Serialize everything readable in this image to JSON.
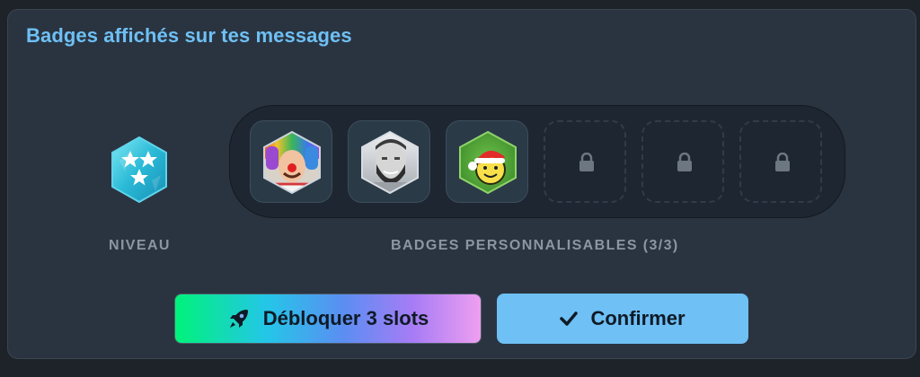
{
  "panel": {
    "title": "Badges affichés sur tes messages"
  },
  "level": {
    "label": "NIVEAU",
    "icon": "three-stars-hexagon-icon"
  },
  "badges": {
    "label": "BADGES PERSONNALISABLES (3/3)",
    "slots": [
      {
        "state": "filled",
        "icon": "clown-avatar-badge"
      },
      {
        "state": "filled",
        "icon": "bearded-man-avatar-badge"
      },
      {
        "state": "filled",
        "icon": "santa-smiley-badge"
      },
      {
        "state": "locked",
        "icon": "lock-icon"
      },
      {
        "state": "locked",
        "icon": "lock-icon"
      },
      {
        "state": "locked",
        "icon": "lock-icon"
      }
    ]
  },
  "buttons": {
    "unlock_label": "Débloquer 3 slots",
    "unlock_icon": "rocket-icon",
    "confirm_label": "Confirmer",
    "confirm_icon": "check-icon"
  },
  "colors": {
    "accent": "#6ec0f5",
    "panel_bg": "#2a3440",
    "page_bg": "#1e2329"
  }
}
